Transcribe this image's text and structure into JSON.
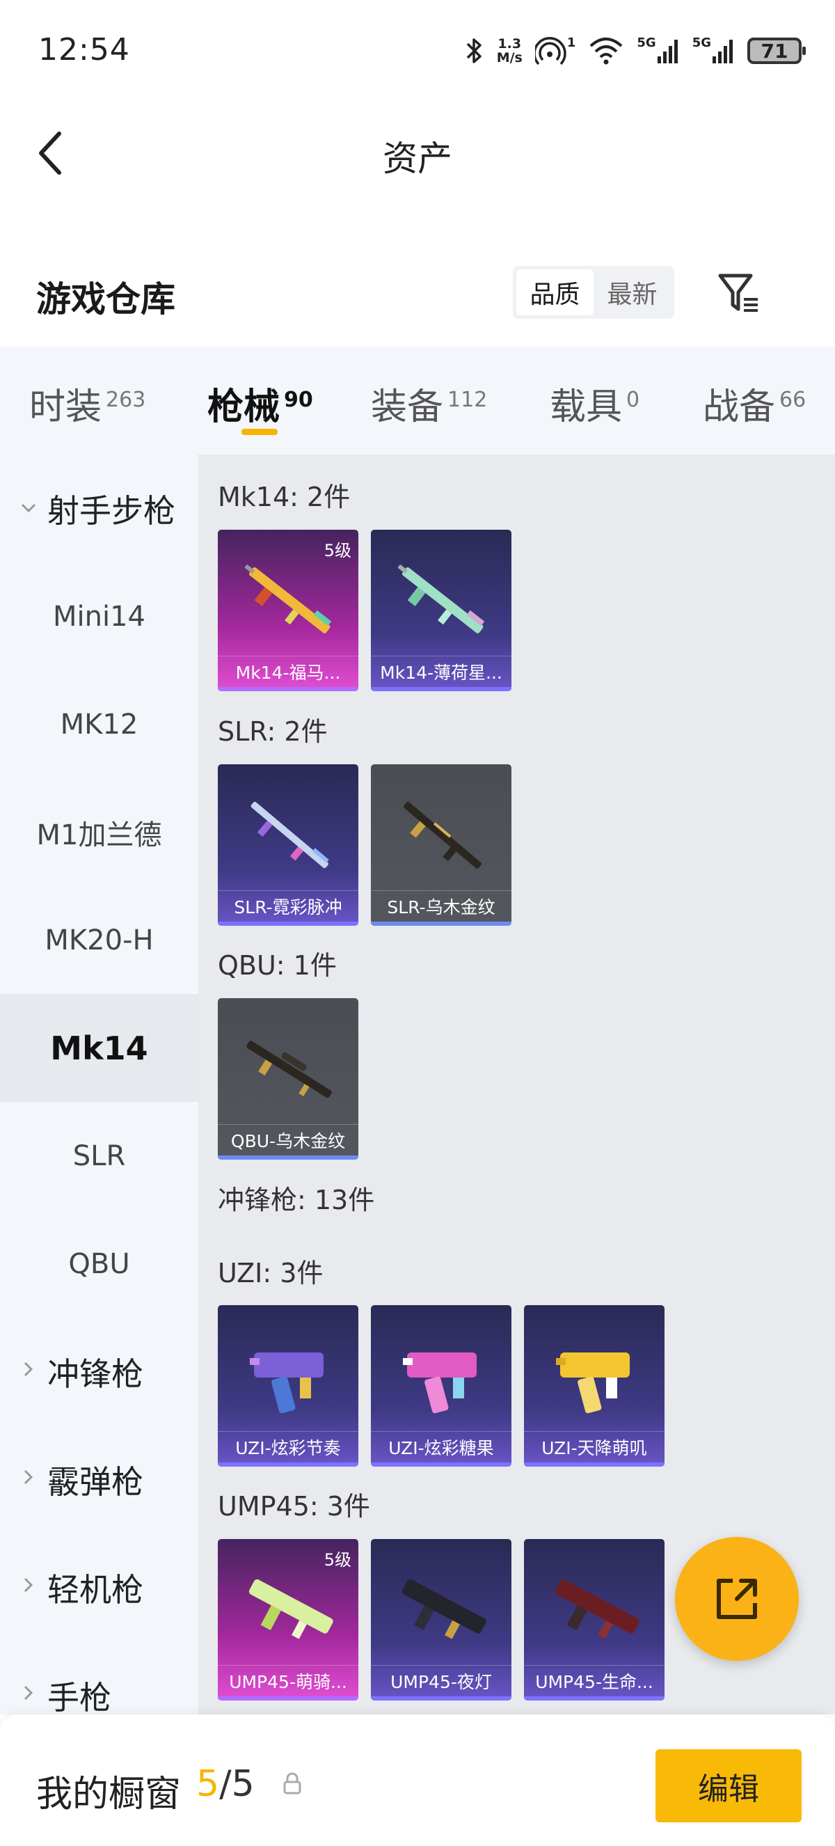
{
  "status_bar": {
    "time": "12:54",
    "speed_value": "1.3",
    "speed_unit": "M/s",
    "hotspot_count": "1",
    "sim1_label": "5G",
    "sim2_label": "5G",
    "battery": "71"
  },
  "header": {
    "title": "资产"
  },
  "warehouse": {
    "title": "游戏仓库",
    "sort_options": [
      "品质",
      "最新"
    ],
    "active_sort": "品质"
  },
  "tabs": [
    {
      "label": "时装",
      "count": "263"
    },
    {
      "label": "枪械",
      "count": "90"
    },
    {
      "label": "装备",
      "count": "112"
    },
    {
      "label": "载具",
      "count": "0"
    },
    {
      "label": "战备",
      "count": "66"
    }
  ],
  "sidebar": {
    "items": [
      {
        "label": "射手步枪",
        "type": "category-expanded"
      },
      {
        "label": "Mini14",
        "type": "item"
      },
      {
        "label": "MK12",
        "type": "item"
      },
      {
        "label": "M1加兰德",
        "type": "item"
      },
      {
        "label": "MK20-H",
        "type": "item"
      },
      {
        "label": "Mk14",
        "type": "item-active"
      },
      {
        "label": "SLR",
        "type": "item"
      },
      {
        "label": "QBU",
        "type": "item"
      },
      {
        "label": "冲锋枪",
        "type": "category-collapsed"
      },
      {
        "label": "霰弹枪",
        "type": "category-collapsed"
      },
      {
        "label": "轻机枪",
        "type": "category-collapsed"
      },
      {
        "label": "手枪",
        "type": "category-collapsed"
      }
    ]
  },
  "groups": [
    {
      "title": "Mk14: 2件",
      "cards": [
        {
          "name": "Mk14-福马...",
          "level": "5级",
          "style": "pink"
        },
        {
          "name": "Mk14-薄荷星...",
          "level": "",
          "style": "purple"
        }
      ]
    },
    {
      "title": "SLR: 2件",
      "cards": [
        {
          "name": "SLR-霓彩脉冲",
          "level": "",
          "style": "purple"
        },
        {
          "name": "SLR-乌木金纹",
          "level": "",
          "style": "gray"
        }
      ]
    },
    {
      "title": "QBU: 1件",
      "cards": [
        {
          "name": "QBU-乌木金纹",
          "level": "",
          "style": "gray"
        }
      ]
    },
    {
      "title": "冲锋枪: 13件",
      "cards": []
    },
    {
      "title": "UZI: 3件",
      "cards": [
        {
          "name": "UZI-炫彩节奏",
          "level": "",
          "style": "purple"
        },
        {
          "name": "UZI-炫彩糖果",
          "level": "",
          "style": "purple"
        },
        {
          "name": "UZI-天降萌叽",
          "level": "",
          "style": "purple"
        }
      ]
    },
    {
      "title": "UMP45: 3件",
      "cards": [
        {
          "name": "UMP45-萌骑...",
          "level": "5级",
          "style": "pink"
        },
        {
          "name": "UMP45-夜灯",
          "level": "",
          "style": "purple"
        },
        {
          "name": "UMP45-生命...",
          "level": "",
          "style": "purple"
        }
      ]
    }
  ],
  "showcase": {
    "title": "我的橱窗",
    "current": "5",
    "separator": "/",
    "total": "5",
    "edit_label": "编辑"
  },
  "colors": {
    "accent": "#f7b500",
    "fab": "#fbb216",
    "sidebar_bg": "#f3f6fa",
    "content_bg": "#e8eaed"
  }
}
